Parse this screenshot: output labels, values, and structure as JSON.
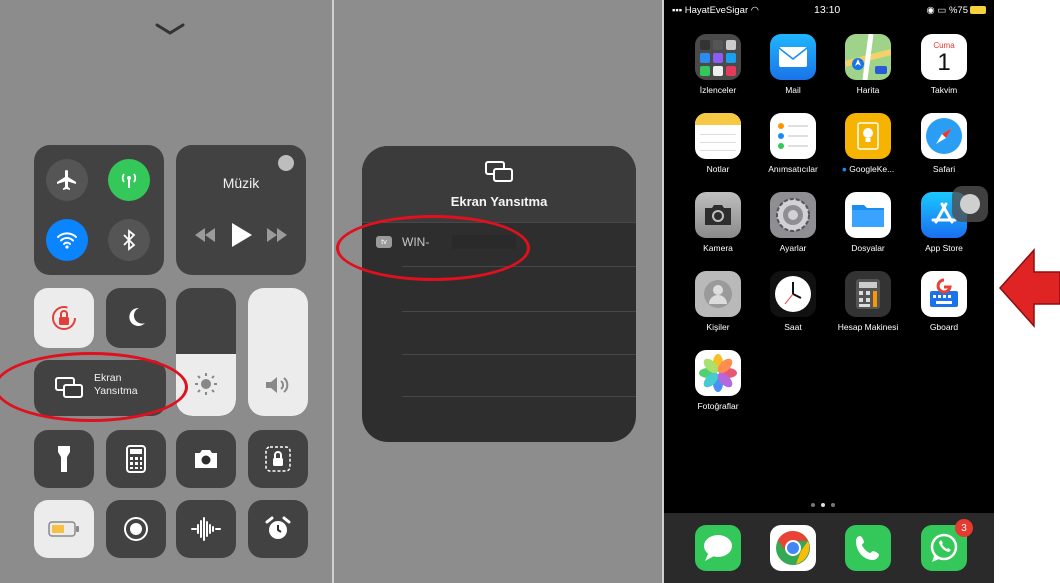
{
  "control_center": {
    "music_title": "Müzik",
    "screen_mirroring_label_line1": "Ekran",
    "screen_mirroring_label_line2": "Yansıtma"
  },
  "screen_mirroring": {
    "title": "Ekran Yansıtma",
    "device_badge": "tv",
    "device_name": "WIN-"
  },
  "home": {
    "status": {
      "carrier": "HayatEveSigar",
      "time": "13:10",
      "battery": "%75"
    },
    "calendar": {
      "day_name": "Cuma",
      "day_number": "1"
    },
    "apps": [
      {
        "label": "İzlenceler"
      },
      {
        "label": "Mail"
      },
      {
        "label": "Harita"
      },
      {
        "label": "Takvim"
      },
      {
        "label": "Notlar"
      },
      {
        "label": "Anımsatıcılar"
      },
      {
        "label": "GoogleKe..."
      },
      {
        "label": "Safari"
      },
      {
        "label": "Kamera"
      },
      {
        "label": "Ayarlar"
      },
      {
        "label": "Dosyalar"
      },
      {
        "label": "App Store"
      },
      {
        "label": "Kişiler"
      },
      {
        "label": "Saat"
      },
      {
        "label": "Hesap Makinesi"
      },
      {
        "label": "Gboard"
      },
      {
        "label": "Fotoğraflar"
      }
    ],
    "whatsapp_badge": "3"
  },
  "colors": {
    "highlight_red": "#e0101e",
    "arrow_red": "#e02424",
    "airplane_active": "#ffffff",
    "cellular_active": "#34c759",
    "wifi_active": "#0a84ff"
  }
}
